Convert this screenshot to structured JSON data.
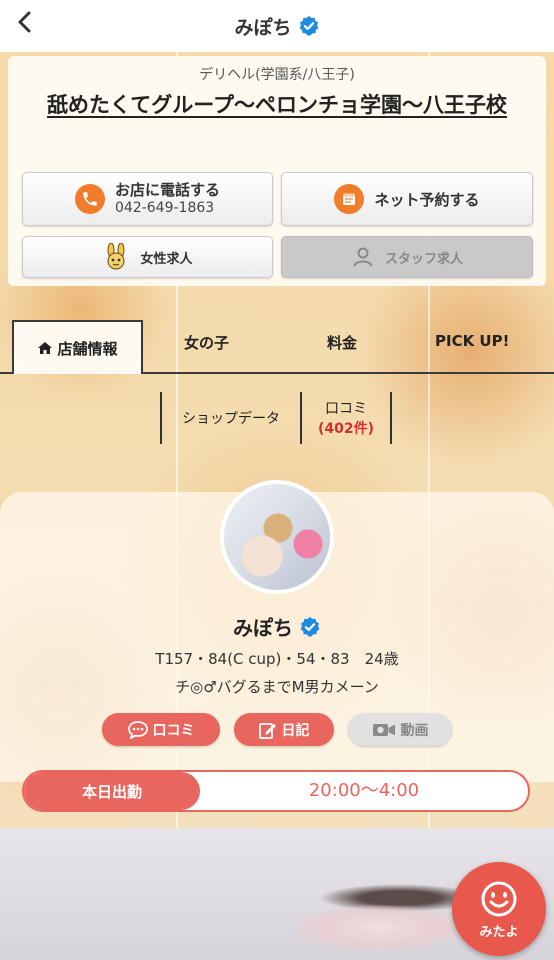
{
  "header": {
    "title": "みぽち"
  },
  "shop": {
    "category": "デリヘル(学園系/八王子)",
    "name": "舐めたくてグループ～ペロンチョ学園～八王子校",
    "call_label": "お店に電話する",
    "phone": "042-649-1863",
    "reserve_label": "ネット予約する",
    "women_jobs_label": "女性求人",
    "staff_jobs_label": "スタッフ求人"
  },
  "tabs": [
    {
      "label": "店舗情報",
      "active": true
    },
    {
      "label": "女の子",
      "active": false
    },
    {
      "label": "料金",
      "active": false
    },
    {
      "label": "PICK UP!",
      "active": false
    }
  ],
  "subtabs": {
    "shop_data": "ショップデータ",
    "reviews": "口コミ",
    "reviews_count": "(402件)"
  },
  "profile": {
    "name": "みぽち",
    "stats": "T157・84(C cup)・54・83　24歳",
    "catchphrase": "チ◎♂バグるまでM男カメーン",
    "review_btn": "口コミ",
    "diary_btn": "日記",
    "video_btn": "動画"
  },
  "schedule": {
    "label": "本日出勤",
    "time": "20:00～4:00"
  },
  "fab": {
    "label": "みたよ"
  },
  "colors": {
    "accent": "#e8665d",
    "orange": "#ef7d2b",
    "verified": "#1d8ce0"
  },
  "icons": [
    "back-chevron-icon",
    "verified-badge-icon",
    "phone-icon",
    "calendar-icon",
    "bunny-mascot-icon",
    "person-icon",
    "home-icon",
    "chat-bubble-icon",
    "edit-icon",
    "video-camera-icon",
    "smiley-icon"
  ]
}
